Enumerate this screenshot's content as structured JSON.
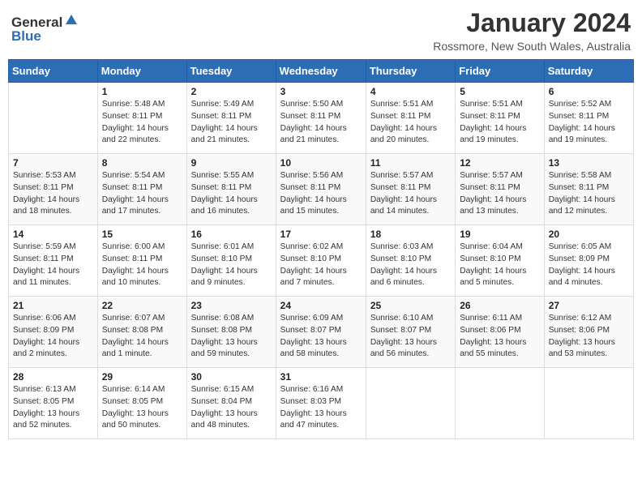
{
  "logo": {
    "general": "General",
    "blue": "Blue"
  },
  "title": "January 2024",
  "subtitle": "Rossmore, New South Wales, Australia",
  "days_of_week": [
    "Sunday",
    "Monday",
    "Tuesday",
    "Wednesday",
    "Thursday",
    "Friday",
    "Saturday"
  ],
  "weeks": [
    [
      {
        "number": "",
        "info": ""
      },
      {
        "number": "1",
        "info": "Sunrise: 5:48 AM\nSunset: 8:11 PM\nDaylight: 14 hours\nand 22 minutes."
      },
      {
        "number": "2",
        "info": "Sunrise: 5:49 AM\nSunset: 8:11 PM\nDaylight: 14 hours\nand 21 minutes."
      },
      {
        "number": "3",
        "info": "Sunrise: 5:50 AM\nSunset: 8:11 PM\nDaylight: 14 hours\nand 21 minutes."
      },
      {
        "number": "4",
        "info": "Sunrise: 5:51 AM\nSunset: 8:11 PM\nDaylight: 14 hours\nand 20 minutes."
      },
      {
        "number": "5",
        "info": "Sunrise: 5:51 AM\nSunset: 8:11 PM\nDaylight: 14 hours\nand 19 minutes."
      },
      {
        "number": "6",
        "info": "Sunrise: 5:52 AM\nSunset: 8:11 PM\nDaylight: 14 hours\nand 19 minutes."
      }
    ],
    [
      {
        "number": "7",
        "info": "Sunrise: 5:53 AM\nSunset: 8:11 PM\nDaylight: 14 hours\nand 18 minutes."
      },
      {
        "number": "8",
        "info": "Sunrise: 5:54 AM\nSunset: 8:11 PM\nDaylight: 14 hours\nand 17 minutes."
      },
      {
        "number": "9",
        "info": "Sunrise: 5:55 AM\nSunset: 8:11 PM\nDaylight: 14 hours\nand 16 minutes."
      },
      {
        "number": "10",
        "info": "Sunrise: 5:56 AM\nSunset: 8:11 PM\nDaylight: 14 hours\nand 15 minutes."
      },
      {
        "number": "11",
        "info": "Sunrise: 5:57 AM\nSunset: 8:11 PM\nDaylight: 14 hours\nand 14 minutes."
      },
      {
        "number": "12",
        "info": "Sunrise: 5:57 AM\nSunset: 8:11 PM\nDaylight: 14 hours\nand 13 minutes."
      },
      {
        "number": "13",
        "info": "Sunrise: 5:58 AM\nSunset: 8:11 PM\nDaylight: 14 hours\nand 12 minutes."
      }
    ],
    [
      {
        "number": "14",
        "info": "Sunrise: 5:59 AM\nSunset: 8:11 PM\nDaylight: 14 hours\nand 11 minutes."
      },
      {
        "number": "15",
        "info": "Sunrise: 6:00 AM\nSunset: 8:11 PM\nDaylight: 14 hours\nand 10 minutes."
      },
      {
        "number": "16",
        "info": "Sunrise: 6:01 AM\nSunset: 8:10 PM\nDaylight: 14 hours\nand 9 minutes."
      },
      {
        "number": "17",
        "info": "Sunrise: 6:02 AM\nSunset: 8:10 PM\nDaylight: 14 hours\nand 7 minutes."
      },
      {
        "number": "18",
        "info": "Sunrise: 6:03 AM\nSunset: 8:10 PM\nDaylight: 14 hours\nand 6 minutes."
      },
      {
        "number": "19",
        "info": "Sunrise: 6:04 AM\nSunset: 8:10 PM\nDaylight: 14 hours\nand 5 minutes."
      },
      {
        "number": "20",
        "info": "Sunrise: 6:05 AM\nSunset: 8:09 PM\nDaylight: 14 hours\nand 4 minutes."
      }
    ],
    [
      {
        "number": "21",
        "info": "Sunrise: 6:06 AM\nSunset: 8:09 PM\nDaylight: 14 hours\nand 2 minutes."
      },
      {
        "number": "22",
        "info": "Sunrise: 6:07 AM\nSunset: 8:08 PM\nDaylight: 14 hours\nand 1 minute."
      },
      {
        "number": "23",
        "info": "Sunrise: 6:08 AM\nSunset: 8:08 PM\nDaylight: 13 hours\nand 59 minutes."
      },
      {
        "number": "24",
        "info": "Sunrise: 6:09 AM\nSunset: 8:07 PM\nDaylight: 13 hours\nand 58 minutes."
      },
      {
        "number": "25",
        "info": "Sunrise: 6:10 AM\nSunset: 8:07 PM\nDaylight: 13 hours\nand 56 minutes."
      },
      {
        "number": "26",
        "info": "Sunrise: 6:11 AM\nSunset: 8:06 PM\nDaylight: 13 hours\nand 55 minutes."
      },
      {
        "number": "27",
        "info": "Sunrise: 6:12 AM\nSunset: 8:06 PM\nDaylight: 13 hours\nand 53 minutes."
      }
    ],
    [
      {
        "number": "28",
        "info": "Sunrise: 6:13 AM\nSunset: 8:05 PM\nDaylight: 13 hours\nand 52 minutes."
      },
      {
        "number": "29",
        "info": "Sunrise: 6:14 AM\nSunset: 8:05 PM\nDaylight: 13 hours\nand 50 minutes."
      },
      {
        "number": "30",
        "info": "Sunrise: 6:15 AM\nSunset: 8:04 PM\nDaylight: 13 hours\nand 48 minutes."
      },
      {
        "number": "31",
        "info": "Sunrise: 6:16 AM\nSunset: 8:03 PM\nDaylight: 13 hours\nand 47 minutes."
      },
      {
        "number": "",
        "info": ""
      },
      {
        "number": "",
        "info": ""
      },
      {
        "number": "",
        "info": ""
      }
    ]
  ]
}
